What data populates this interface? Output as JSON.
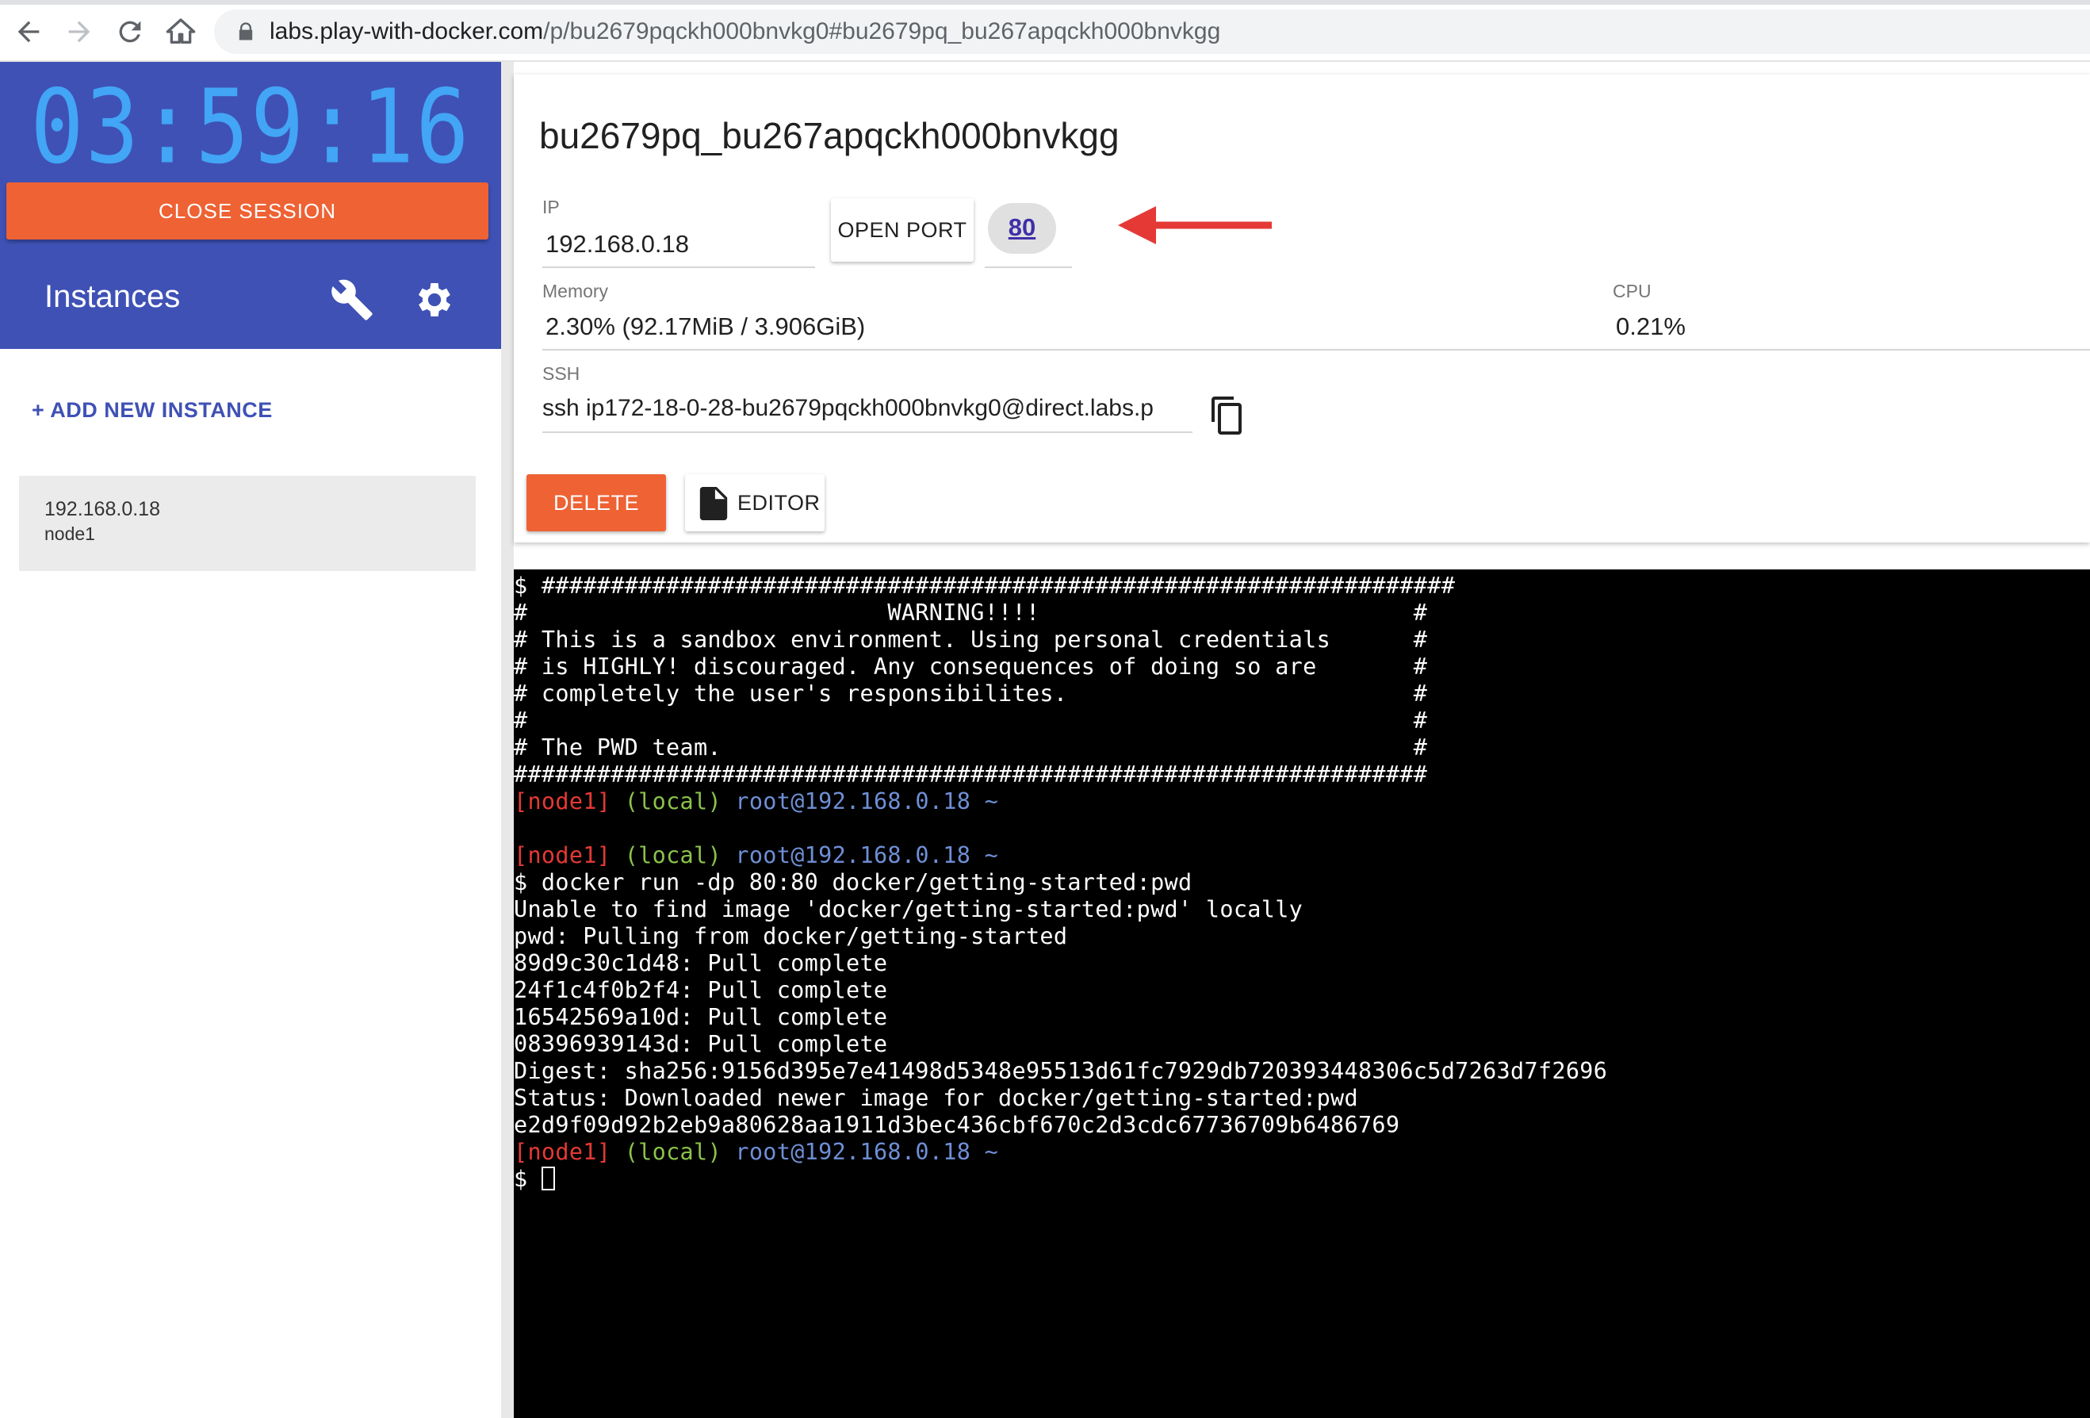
{
  "browser": {
    "url_host": "labs.play-with-docker.com",
    "url_path": "/p/bu2679pqckh000bnvkg0#bu2679pq_bu267apqckh000bnvkgg"
  },
  "sidebar": {
    "timer": "03:59:16",
    "close_session_label": "CLOSE SESSION",
    "instances_title": "Instances",
    "add_instance_label": "+ ADD NEW INSTANCE",
    "instance": {
      "ip": "192.168.0.18",
      "name": "node1"
    }
  },
  "card": {
    "host_title": "bu2679pq_bu267apqckh000bnvkgg",
    "ip_label": "IP",
    "ip_value": "192.168.0.18",
    "open_port_label": "OPEN PORT",
    "port_badge": "80",
    "memory_label": "Memory",
    "memory_value": "2.30% (92.17MiB / 3.906GiB)",
    "cpu_label": "CPU",
    "cpu_value": "0.21%",
    "ssh_label": "SSH",
    "ssh_value": "ssh ip172-18-0-28-bu2679pqckh000bnvkg0@direct.labs.p",
    "delete_label": "DELETE",
    "editor_label": "EDITOR"
  },
  "colors": {
    "sidebar_header": "#3f51b5",
    "timer": "#42a5f5",
    "accent_orange": "#ee6234",
    "annotation_arrow": "#e53935"
  },
  "terminal": {
    "node": "[node1]",
    "local": "(local)",
    "user": "root@192.168.0.18 ~",
    "lines": [
      "$ ##################################################################",
      "#                          WARNING!!!!                           #",
      "# This is a sandbox environment. Using personal credentials      #",
      "# is HIGHLY! discouraged. Any consequences of doing so are       #",
      "# completely the user's responsibilites.                         #",
      "#                                                                #",
      "# The PWD team.                                                  #",
      "##################################################################",
      "",
      "",
      "",
      "$ docker run -dp 80:80 docker/getting-started:pwd",
      "Unable to find image 'docker/getting-started:pwd' locally",
      "pwd: Pulling from docker/getting-started",
      "89d9c30c1d48: Pull complete",
      "24f1c4f0b2f4: Pull complete",
      "16542569a10d: Pull complete",
      "08396939143d: Pull complete",
      "Digest: sha256:9156d395e7e41498d5348e95513d61fc7929db720393448306c5d7263d7f2696",
      "Status: Downloaded newer image for docker/getting-started:pwd",
      "e2d9f09d92b2eb9a80628aa1911d3bec436cbf670c2d3cdc67736709b6486769"
    ],
    "final_prompt_symbol": "$ "
  }
}
